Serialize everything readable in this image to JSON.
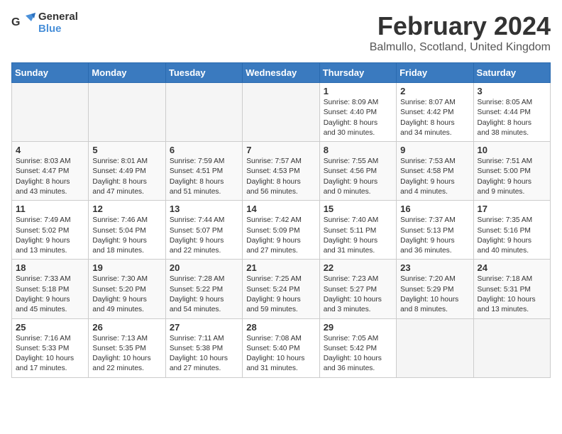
{
  "header": {
    "logo_line1": "General",
    "logo_line2": "Blue",
    "month_year": "February 2024",
    "location": "Balmullo, Scotland, United Kingdom"
  },
  "columns": [
    "Sunday",
    "Monday",
    "Tuesday",
    "Wednesday",
    "Thursday",
    "Friday",
    "Saturday"
  ],
  "weeks": [
    [
      {
        "day": "",
        "content": ""
      },
      {
        "day": "",
        "content": ""
      },
      {
        "day": "",
        "content": ""
      },
      {
        "day": "",
        "content": ""
      },
      {
        "day": "1",
        "content": "Sunrise: 8:09 AM\nSunset: 4:40 PM\nDaylight: 8 hours\nand 30 minutes."
      },
      {
        "day": "2",
        "content": "Sunrise: 8:07 AM\nSunset: 4:42 PM\nDaylight: 8 hours\nand 34 minutes."
      },
      {
        "day": "3",
        "content": "Sunrise: 8:05 AM\nSunset: 4:44 PM\nDaylight: 8 hours\nand 38 minutes."
      }
    ],
    [
      {
        "day": "4",
        "content": "Sunrise: 8:03 AM\nSunset: 4:47 PM\nDaylight: 8 hours\nand 43 minutes."
      },
      {
        "day": "5",
        "content": "Sunrise: 8:01 AM\nSunset: 4:49 PM\nDaylight: 8 hours\nand 47 minutes."
      },
      {
        "day": "6",
        "content": "Sunrise: 7:59 AM\nSunset: 4:51 PM\nDaylight: 8 hours\nand 51 minutes."
      },
      {
        "day": "7",
        "content": "Sunrise: 7:57 AM\nSunset: 4:53 PM\nDaylight: 8 hours\nand 56 minutes."
      },
      {
        "day": "8",
        "content": "Sunrise: 7:55 AM\nSunset: 4:56 PM\nDaylight: 9 hours\nand 0 minutes."
      },
      {
        "day": "9",
        "content": "Sunrise: 7:53 AM\nSunset: 4:58 PM\nDaylight: 9 hours\nand 4 minutes."
      },
      {
        "day": "10",
        "content": "Sunrise: 7:51 AM\nSunset: 5:00 PM\nDaylight: 9 hours\nand 9 minutes."
      }
    ],
    [
      {
        "day": "11",
        "content": "Sunrise: 7:49 AM\nSunset: 5:02 PM\nDaylight: 9 hours\nand 13 minutes."
      },
      {
        "day": "12",
        "content": "Sunrise: 7:46 AM\nSunset: 5:04 PM\nDaylight: 9 hours\nand 18 minutes."
      },
      {
        "day": "13",
        "content": "Sunrise: 7:44 AM\nSunset: 5:07 PM\nDaylight: 9 hours\nand 22 minutes."
      },
      {
        "day": "14",
        "content": "Sunrise: 7:42 AM\nSunset: 5:09 PM\nDaylight: 9 hours\nand 27 minutes."
      },
      {
        "day": "15",
        "content": "Sunrise: 7:40 AM\nSunset: 5:11 PM\nDaylight: 9 hours\nand 31 minutes."
      },
      {
        "day": "16",
        "content": "Sunrise: 7:37 AM\nSunset: 5:13 PM\nDaylight: 9 hours\nand 36 minutes."
      },
      {
        "day": "17",
        "content": "Sunrise: 7:35 AM\nSunset: 5:16 PM\nDaylight: 9 hours\nand 40 minutes."
      }
    ],
    [
      {
        "day": "18",
        "content": "Sunrise: 7:33 AM\nSunset: 5:18 PM\nDaylight: 9 hours\nand 45 minutes."
      },
      {
        "day": "19",
        "content": "Sunrise: 7:30 AM\nSunset: 5:20 PM\nDaylight: 9 hours\nand 49 minutes."
      },
      {
        "day": "20",
        "content": "Sunrise: 7:28 AM\nSunset: 5:22 PM\nDaylight: 9 hours\nand 54 minutes."
      },
      {
        "day": "21",
        "content": "Sunrise: 7:25 AM\nSunset: 5:24 PM\nDaylight: 9 hours\nand 59 minutes."
      },
      {
        "day": "22",
        "content": "Sunrise: 7:23 AM\nSunset: 5:27 PM\nDaylight: 10 hours\nand 3 minutes."
      },
      {
        "day": "23",
        "content": "Sunrise: 7:20 AM\nSunset: 5:29 PM\nDaylight: 10 hours\nand 8 minutes."
      },
      {
        "day": "24",
        "content": "Sunrise: 7:18 AM\nSunset: 5:31 PM\nDaylight: 10 hours\nand 13 minutes."
      }
    ],
    [
      {
        "day": "25",
        "content": "Sunrise: 7:16 AM\nSunset: 5:33 PM\nDaylight: 10 hours\nand 17 minutes."
      },
      {
        "day": "26",
        "content": "Sunrise: 7:13 AM\nSunset: 5:35 PM\nDaylight: 10 hours\nand 22 minutes."
      },
      {
        "day": "27",
        "content": "Sunrise: 7:11 AM\nSunset: 5:38 PM\nDaylight: 10 hours\nand 27 minutes."
      },
      {
        "day": "28",
        "content": "Sunrise: 7:08 AM\nSunset: 5:40 PM\nDaylight: 10 hours\nand 31 minutes."
      },
      {
        "day": "29",
        "content": "Sunrise: 7:05 AM\nSunset: 5:42 PM\nDaylight: 10 hours\nand 36 minutes."
      },
      {
        "day": "",
        "content": ""
      },
      {
        "day": "",
        "content": ""
      }
    ]
  ]
}
